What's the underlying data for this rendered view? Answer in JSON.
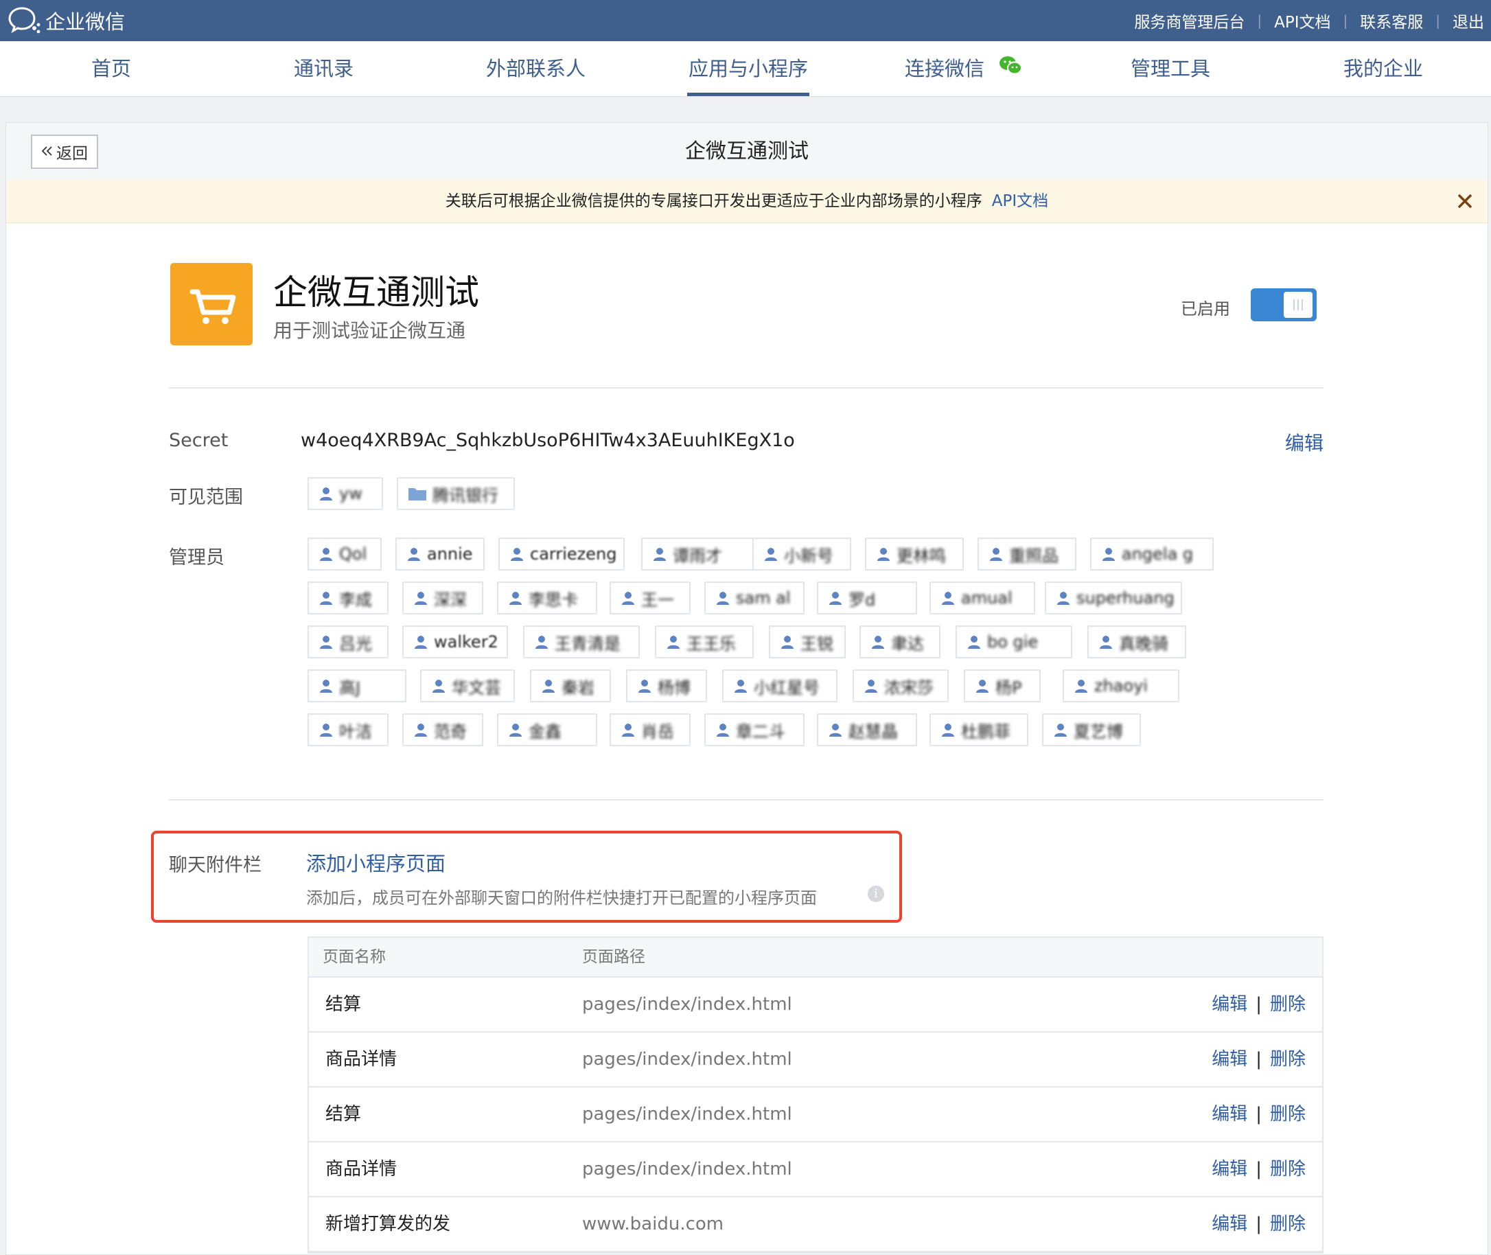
{
  "app_brand": "企业微信",
  "top_links": [
    "服务商管理后台",
    "API文档",
    "联系客服",
    "退出"
  ],
  "nav": [
    {
      "label": "首页",
      "active": false
    },
    {
      "label": "通讯录",
      "active": false
    },
    {
      "label": "外部联系人",
      "active": false
    },
    {
      "label": "应用与小程序",
      "active": true
    },
    {
      "label": "连接微信",
      "active": false
    },
    {
      "label": "管理工具",
      "active": false
    },
    {
      "label": "我的企业",
      "active": false
    }
  ],
  "panel": {
    "back_label": "返回",
    "title": "企微互通测试",
    "notice": "关联后可根据企业微信提供的专属接口开发出更适应于企业内部场景的小程序",
    "notice_link": "API文档"
  },
  "app": {
    "name": "企微互通测试",
    "description": "用于测试验证企微互通",
    "status_label": "已启用",
    "enabled": true
  },
  "secret": {
    "label": "Secret",
    "value": "w4oeq4XRB9Ac_SqhkzbUsoP6HITw4x3AEuuhIKEgX1o",
    "edit_label": "编辑"
  },
  "visible_range": {
    "label": "可见范围",
    "items": [
      "yw",
      "腾讯银行"
    ]
  },
  "admins": {
    "label": "管理员",
    "names": [
      "Qol",
      "annie",
      "carriezeng",
      "谭雨才",
      "小新号",
      "更林鸣",
      "重照品",
      "angela g",
      "李成",
      "深深",
      "李思卡",
      "王一",
      "sam al",
      "罗d",
      "amual",
      "superhuang",
      "吕光",
      "walker2",
      "王青清是",
      "王王乐",
      "王锐",
      "聿达",
      "bo gie",
      "真晚骑",
      "高J",
      "华文芸",
      "秦岩",
      "杨博",
      "小红星号",
      "浓宋莎",
      "杨P",
      "zhaoyi",
      "叶洁",
      "范奇",
      "金鑫",
      "肖岳",
      "章二斗",
      "赵慧晶",
      "杜鹏菲",
      "夏艺博"
    ]
  },
  "chat_attachment": {
    "label": "聊天附件栏",
    "add_link": "添加小程序页面",
    "hint": "添加后，成员可在外部聊天窗口的附件栏快捷打开已配置的小程序页面",
    "info_icon": "i"
  },
  "pages_table": {
    "headers": [
      "页面名称",
      "页面路径"
    ],
    "edit_label": "编辑",
    "delete_label": "删除",
    "rows": [
      {
        "name": "结算",
        "path": "pages/index/index.html"
      },
      {
        "name": "商品详情",
        "path": "pages/index/index.html"
      },
      {
        "name": "结算",
        "path": "pages/index/index.html"
      },
      {
        "name": "商品详情",
        "path": "pages/index/index.html"
      },
      {
        "name": "新增打算发的发",
        "path": "www.baidu.com"
      }
    ]
  },
  "colors": {
    "topbar": "#3f5f8d",
    "nav_text": "#3d5e8f",
    "link": "#2f5da6",
    "app_icon": "#f6a623",
    "toggle_on": "#3b86d3",
    "highlight_border": "#e8452c",
    "wechat_green": "#46b52e"
  },
  "icons": {
    "logo": "wecom-logo-icon",
    "wechat": "wechat-icon",
    "back": "double-chevron-left-icon",
    "close": "close-icon",
    "app": "shopping-cart-icon",
    "user": "user-icon",
    "folder": "folder-icon",
    "info": "info-icon"
  }
}
